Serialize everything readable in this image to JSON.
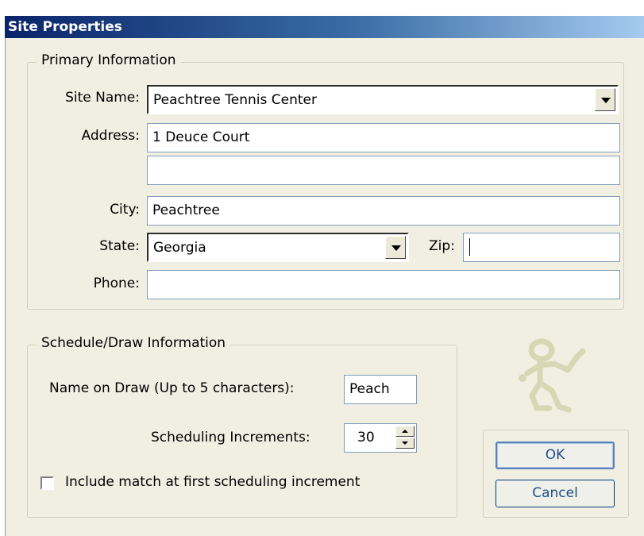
{
  "window": {
    "title": "Site Properties"
  },
  "primary": {
    "legend": "Primary Information",
    "site_name_label": "Site Name:",
    "site_name_value": "Peachtree Tennis Center",
    "address_label": "Address:",
    "address1_value": "1 Deuce Court",
    "address2_value": "",
    "city_label": "City:",
    "city_value": "Peachtree",
    "state_label": "State:",
    "state_value": "Georgia",
    "zip_label": "Zip:",
    "zip_value": "",
    "phone_label": "Phone:",
    "phone_value": ""
  },
  "schedule": {
    "legend": "Schedule/Draw Information",
    "draw_name_label": "Name on Draw (Up to 5 characters):",
    "draw_name_value": "Peach",
    "increments_label": "Scheduling Increments:",
    "increments_value": "30",
    "include_match_label": "Include match at first scheduling increment",
    "include_match_checked": false
  },
  "buttons": {
    "ok": "OK",
    "cancel": "Cancel"
  },
  "icons": {
    "mascot": "tennis-stick-figure-icon"
  }
}
